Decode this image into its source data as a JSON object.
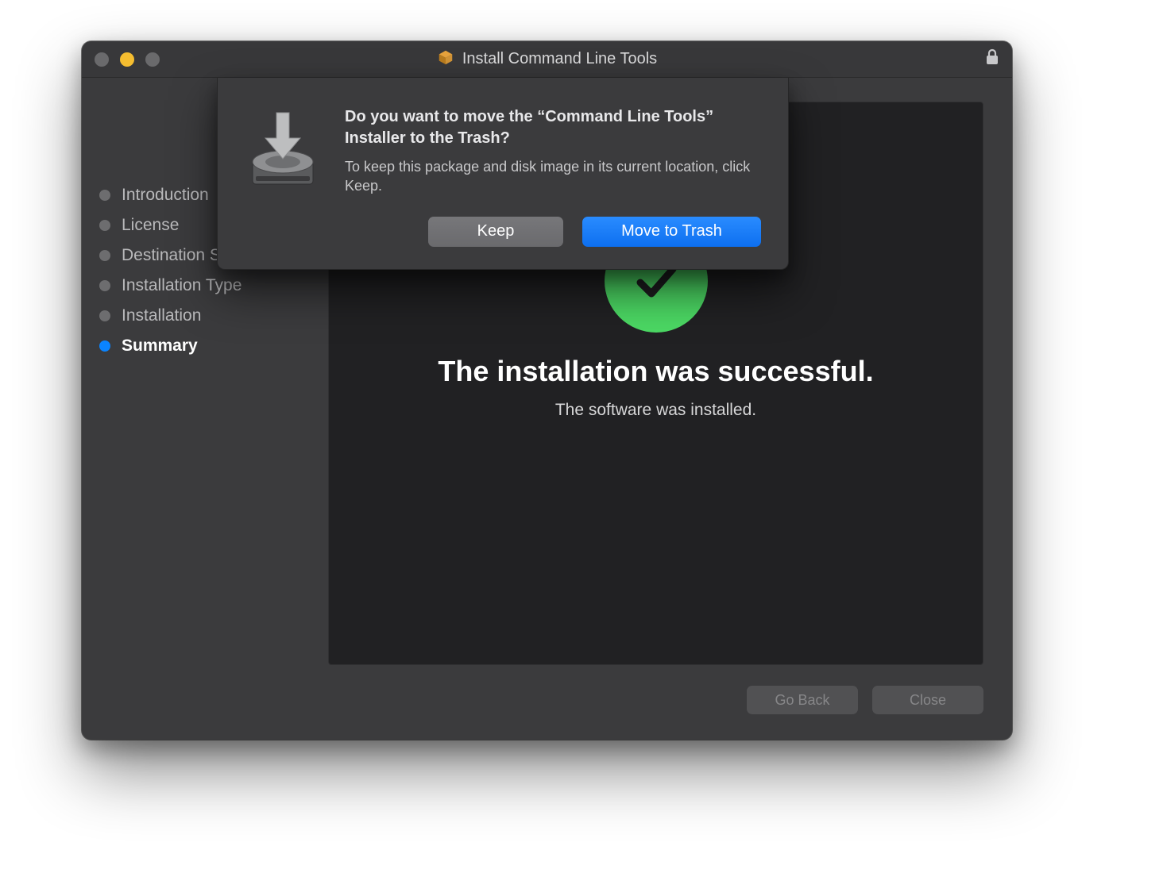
{
  "window": {
    "title": "Install Command Line Tools"
  },
  "sidebar": {
    "steps": [
      {
        "label": "Introduction"
      },
      {
        "label": "License"
      },
      {
        "label": "Destination Select"
      },
      {
        "label": "Installation Type"
      },
      {
        "label": "Installation"
      },
      {
        "label": "Summary"
      }
    ],
    "active_index": 5
  },
  "main": {
    "headline": "The installation was successful.",
    "subline": "The software was installed."
  },
  "footer": {
    "back_label": "Go Back",
    "close_label": "Close"
  },
  "sheet": {
    "title": "Do you want to move the “Command Line Tools” Installer to the Trash?",
    "description": "To keep this package and disk image in its current location, click Keep.",
    "keep_label": "Keep",
    "trash_label": "Move to Trash"
  }
}
